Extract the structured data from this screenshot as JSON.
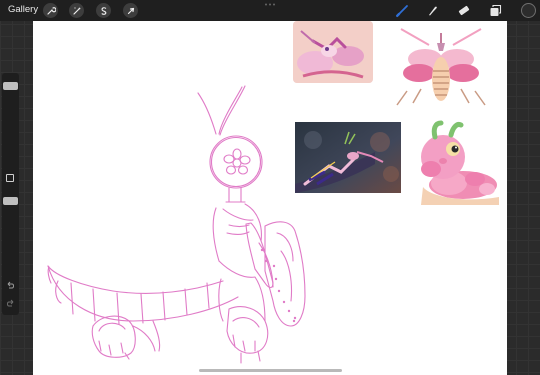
{
  "topbar": {
    "gallery_label": "Gallery",
    "actions_icon": "wrench-icon",
    "adjustments_icon": "magic-wand-icon",
    "selection_icon": "selection-s-icon",
    "transform_icon": "arrow-cursor-icon",
    "brush_icon": "brush-icon",
    "smudge_icon": "smudge-icon",
    "eraser_icon": "eraser-icon",
    "layers_icon": "layers-icon",
    "active_color": "#2b2b2b",
    "accent_color": "#2f6fd6"
  },
  "sidebar": {
    "brush_size_level": 0.05,
    "opacity_level": 0.55,
    "modify_icon": "square-icon",
    "undo_icon": "undo-arrow-icon",
    "redo_icon": "redo-arrow-icon"
  },
  "canvas": {
    "background": "#ffffff",
    "sketch_color": "#e07bc7",
    "reference_images": [
      "orchid-mantis-photo-1",
      "orchid-mantis-specimen",
      "orchid-mantis-on-hand",
      "orchid-mantis-plush-toy"
    ]
  }
}
